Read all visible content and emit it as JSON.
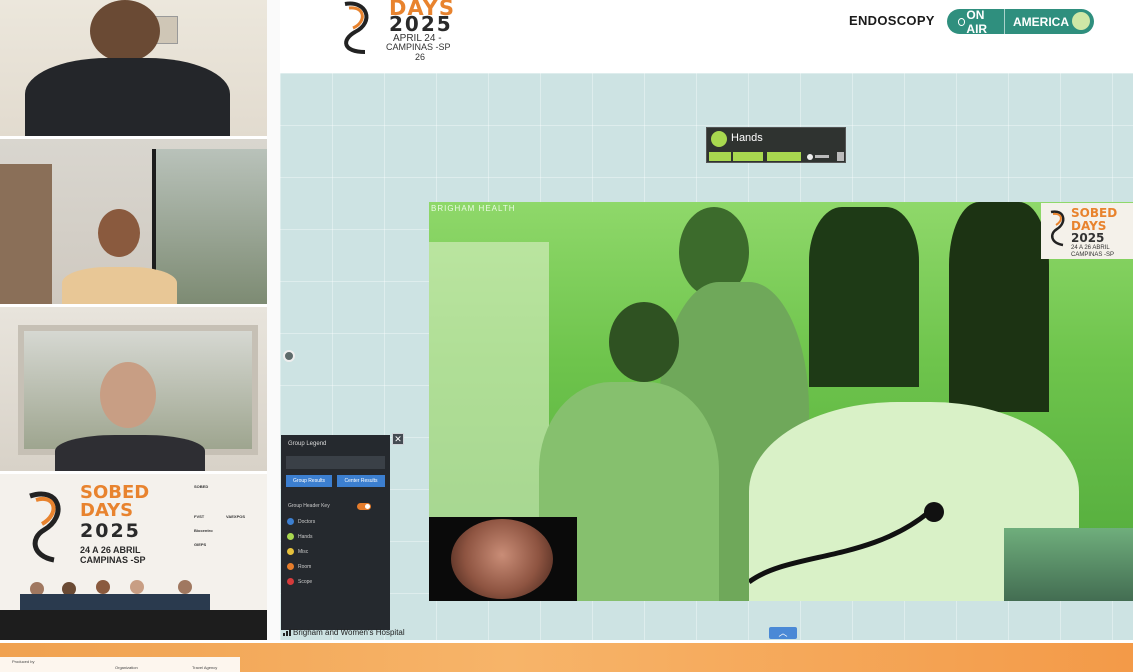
{
  "header": {
    "logo_title": "DAYS",
    "logo_year": "2025",
    "logo_date_line1": "APRIL 24 -",
    "logo_date_line2": "CAMPINAS -SP",
    "logo_date_line3": "26",
    "channel_label": "ENDOSCOPY",
    "onair_label": "ON AIR",
    "region_label": "AMERICA"
  },
  "whiteboard": {
    "group_card": {
      "label": "Hands",
      "color": "#a8d84f"
    },
    "legend": {
      "title": "Group Legend",
      "btn_group_results": "Group Results",
      "btn_center_results": "Center Results",
      "header_key_label": "Group Header Key",
      "items": [
        {
          "label": "Doctors",
          "color": "#3c7fd0"
        },
        {
          "label": "Hands",
          "color": "#a8d84f"
        },
        {
          "label": "Misc",
          "color": "#e6c13c"
        },
        {
          "label": "Room",
          "color": "#e57c2b"
        },
        {
          "label": "Scope",
          "color": "#d63b3b"
        }
      ]
    },
    "video": {
      "source_label": "Brigham and Women's Hospital",
      "overlay_label": "BRIGHAM HEALTH",
      "badge_title": "SOBED",
      "badge_days": "DAYS",
      "badge_year": "2025",
      "badge_dates": "24 A 26 ABRIL",
      "badge_city": "CAMPINAS -SP"
    }
  },
  "participants": {
    "panel_logo_line1": "SOBED",
    "panel_logo_line2": "DAYS",
    "panel_logo_year": "2025",
    "panel_logo_dates": "24 A 26 ABRIL",
    "panel_logo_city": "CAMPINAS -SP",
    "sponsors": [
      "SOBED",
      "FVST",
      "VAEXPOS",
      "Biocentro",
      "GIEPS"
    ]
  },
  "footer": {
    "produced_by": "Produced by",
    "organization": "Organization",
    "travel_agency": "Travel Agency"
  }
}
